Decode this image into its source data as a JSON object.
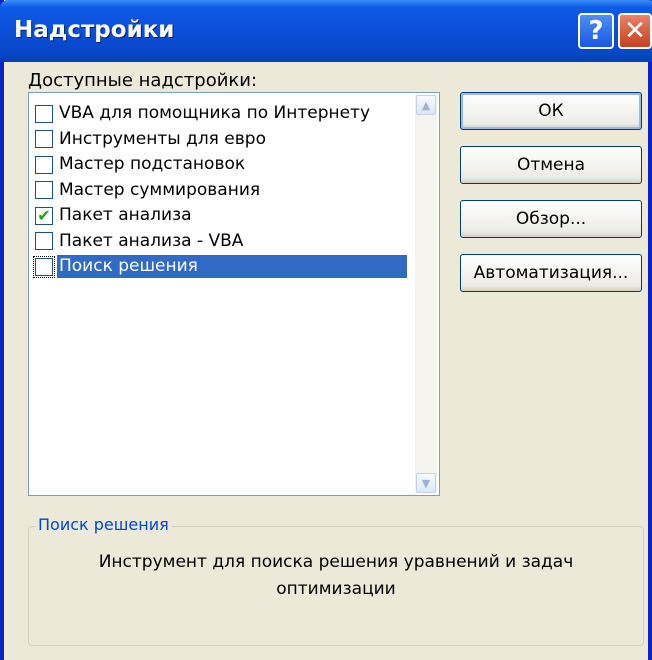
{
  "window": {
    "title": "Надстройки",
    "help_glyph": "?",
    "close_glyph": "✕"
  },
  "addins": {
    "label": "Доступные надстройки:",
    "items": [
      {
        "label": "VBA для помощника по Интернету",
        "checked": false,
        "selected": false
      },
      {
        "label": "Инструменты для евро",
        "checked": false,
        "selected": false
      },
      {
        "label": "Мастер подстановок",
        "checked": false,
        "selected": false
      },
      {
        "label": "Мастер суммирования",
        "checked": false,
        "selected": false
      },
      {
        "label": "Пакет анализа",
        "checked": true,
        "selected": false
      },
      {
        "label": "Пакет анализа - VBA",
        "checked": false,
        "selected": false
      },
      {
        "label": "Поиск решения",
        "checked": false,
        "selected": true
      }
    ]
  },
  "buttons": {
    "ok": "ОК",
    "cancel": "Отмена",
    "browse": "Обзор...",
    "automation": "Автоматизация..."
  },
  "description": {
    "title": "Поиск решения",
    "text": "Инструмент для поиска решения уравнений и задач оптимизации"
  },
  "icons": {
    "scroll_up": "up-arrow-icon",
    "scroll_down": "down-arrow-icon",
    "check": "checkmark-icon"
  },
  "colors": {
    "title_bar": "#0A4FD8",
    "selection": "#316AC5",
    "dialog_bg": "#ECE9D8",
    "group_title": "#0046D5",
    "check": "#21A121"
  }
}
